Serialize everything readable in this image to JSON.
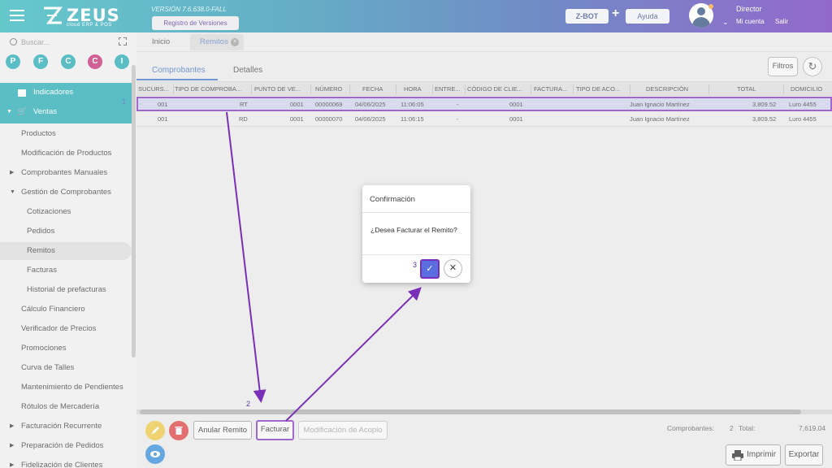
{
  "header": {
    "logo_text": "ZEUS",
    "logo_sub": "cloud ERP & POS",
    "version": "VERSIÓN 7.6.638.0-FALL",
    "registro_label": "Registro de Versiones",
    "zbot_label": "Z-BOT",
    "plus": "+",
    "ayuda_label": "Ayuda",
    "user_name": "Director",
    "mi_cuenta": "Mi cuenta",
    "salir": "Salir"
  },
  "sidebar": {
    "search_placeholder": "Buscar...",
    "quick_buttons": [
      {
        "label": "P",
        "color": "#1ba5ad"
      },
      {
        "label": "F",
        "color": "#1ba5ad"
      },
      {
        "label": "C",
        "color": "#1ba5ad"
      },
      {
        "label": "C",
        "color": "#c0246c"
      },
      {
        "label": "I",
        "color": "#1ba5ad"
      }
    ],
    "badge": "1",
    "items": [
      {
        "label": "Indicadores"
      },
      {
        "label": "Ventas"
      },
      {
        "label": "Productos"
      },
      {
        "label": "Modificación de Productos"
      },
      {
        "label": "Comprobantes Manuales"
      },
      {
        "label": "Gestión de Comprobantes"
      },
      {
        "label": "Cotizaciones"
      },
      {
        "label": "Pedidos"
      },
      {
        "label": "Remitos"
      },
      {
        "label": "Facturas"
      },
      {
        "label": "Historial de prefacturas"
      },
      {
        "label": "Cálculo Financiero"
      },
      {
        "label": "Verificador de Precios"
      },
      {
        "label": "Promociones"
      },
      {
        "label": "Curva de Talles"
      },
      {
        "label": "Mantenimiento de Pendientes"
      },
      {
        "label": "Rótulos de Mercadería"
      },
      {
        "label": "Facturación Recurrente"
      },
      {
        "label": "Preparación de Pedidos"
      },
      {
        "label": "Fidelización de Clientes"
      }
    ]
  },
  "tabs": {
    "inicio": "Inicio",
    "remitos": "Remitos",
    "close": "×"
  },
  "subtabs": {
    "comprobantes": "Comprobantes",
    "detalles": "Detalles"
  },
  "toolbar": {
    "filtros": "Filtros",
    "refresh": "↻"
  },
  "table": {
    "columns": [
      "SUCURS...",
      "TIPO DE COMPROBA...",
      "PUNTO DE VE...",
      "NÚMERO",
      "FECHA",
      "HORA",
      "ENTRE...",
      "CÓDIGO DE CLIE...",
      "FACTURA...",
      "TIPO DE ACO...",
      "DESCRIPCIÓN",
      "TOTAL",
      "DOMICILIO"
    ],
    "rows": [
      {
        "sucursal": "001",
        "tipo": "RT",
        "punto": "0001",
        "numero": "00000069",
        "fecha": "04/06/2025",
        "hora": "11:06:05",
        "entrega": "-",
        "codigo": "0001",
        "descripcion": "Juan Ignacio Martínez",
        "total": "3,809.52",
        "domicilio": "Luro 4455"
      },
      {
        "sucursal": "001",
        "tipo": "RD",
        "punto": "0001",
        "numero": "00000070",
        "fecha": "04/06/2025",
        "hora": "11:06:15",
        "entrega": "-",
        "codigo": "0001",
        "descripcion": "Juan Ignacio Martínez",
        "total": "3,809.52",
        "domicilio": "Luro 4455"
      }
    ]
  },
  "bottom": {
    "anular": "Anular Remito",
    "facturar": "Facturar",
    "modificacion": "Modificación de Acopio",
    "comprobantes_label": "Comprobantes:",
    "comprobantes_count": "2",
    "total_label": "Total:",
    "total_value": "7,619.04",
    "imprimir": "Imprimir",
    "exportar": "Exportar"
  },
  "modal": {
    "title": "Confirmación",
    "message": "¿Desea Facturar el Remito?",
    "confirm_icon": "check-icon",
    "cancel_icon": "close-icon"
  },
  "annotations": {
    "step2": "2",
    "step3": "3",
    "color": "#7a2fb8"
  }
}
